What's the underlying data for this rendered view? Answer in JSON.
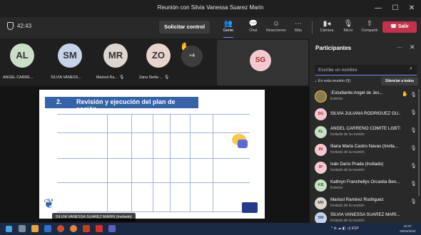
{
  "window": {
    "title": "Reunión con Silvia Vanessa Suarez Marin",
    "minimize_glyph": "—",
    "maximize_glyph": "☐",
    "close_glyph": "✕"
  },
  "toolbar": {
    "timer": "42:43",
    "request_control": "Solicitar control",
    "items": [
      {
        "label": "Gente",
        "icon": "people-icon",
        "glyph": "👥",
        "badge": "2"
      },
      {
        "label": "Chat",
        "icon": "chat-icon",
        "glyph": "💬"
      },
      {
        "label": "Reacciones",
        "icon": "reactions-icon",
        "glyph": "☺"
      },
      {
        "label": "Más",
        "icon": "more-icon",
        "glyph": "⋯"
      },
      {
        "label": "Cámara",
        "icon": "camera-off-icon",
        "glyph": "▮◂"
      },
      {
        "label": "Micro",
        "icon": "mic-off-icon",
        "glyph": "🎙"
      },
      {
        "label": "Compartir",
        "icon": "share-icon",
        "glyph": "⇧"
      }
    ],
    "leave_label": "Salir",
    "leave_color": "#c4314b"
  },
  "gallery": {
    "tiles": [
      {
        "initials": "AL",
        "name": "ANGEL CARRE...",
        "color": "#c9dfc6",
        "mic": ""
      },
      {
        "initials": "SM",
        "name": "SILVIA VANESS...",
        "color": "#c7d3e8",
        "mic": ""
      },
      {
        "initials": "MR",
        "name": "Marisol Ra...",
        "color": "#ddd5cf",
        "mic": "🎙"
      },
      {
        "initials": "ZO",
        "name": "Zaira Stella ...",
        "color": "#e8d3cf",
        "mic": "🎙"
      }
    ],
    "more_count": "+4",
    "self_initials": "SG"
  },
  "slide": {
    "number": "2.",
    "title": "Revisión y ejecución del plan de acción.",
    "speaker_label": "SILVIA VANESSA SUAREZ MARIN (Invitado)"
  },
  "panel": {
    "title": "Participantes",
    "search_placeholder": "Escribe un nombre",
    "section": "En esta reunión (9)",
    "mute_all": "Silenciar a todos",
    "participants": [
      {
        "initials": "",
        "name": ":Estudiante:Angel de Jes...",
        "role": "Externo",
        "color": "#8a7a5a",
        "hand": true
      },
      {
        "initials": "SG",
        "name": "SILVIA JULIANA RODRIGUEZ GU...",
        "role": "",
        "color": "#f3c9d1"
      },
      {
        "initials": "AL",
        "name": "ANGEL CARREÑO COMITE LGBTI...",
        "role": "Invitado de la reunión",
        "color": "#c9dfc6"
      },
      {
        "initials": "IN",
        "name": "Iliana Maria Castro Navas (Invita...",
        "role": "Invitado de la reunión",
        "color": "#f3c9d1"
      },
      {
        "initials": "IP",
        "name": "Iván Darío Prada (Invitado)",
        "role": "Invitado de la reunión",
        "color": "#f3c9d1"
      },
      {
        "initials": "KB",
        "name": "Kathryn Franchellys Orcasita Ben...",
        "role": "Externo",
        "color": "#c9dfc6"
      },
      {
        "initials": "MR",
        "name": "Marisol Ramirez Rodriguez",
        "role": "Invitado de la reunión",
        "color": "#ddd5cf"
      },
      {
        "initials": "SM",
        "name": "SILVIA VANESSA SUAREZ MARI...",
        "role": "Invitado de la reunión",
        "color": "#c7d3e8"
      }
    ]
  },
  "taskbar": {
    "tray_text": "^ ⊕ ☁ ◧ ◁) ESP",
    "tray_sub": "LAA",
    "time": "10:47",
    "date": "25/04/2022"
  }
}
